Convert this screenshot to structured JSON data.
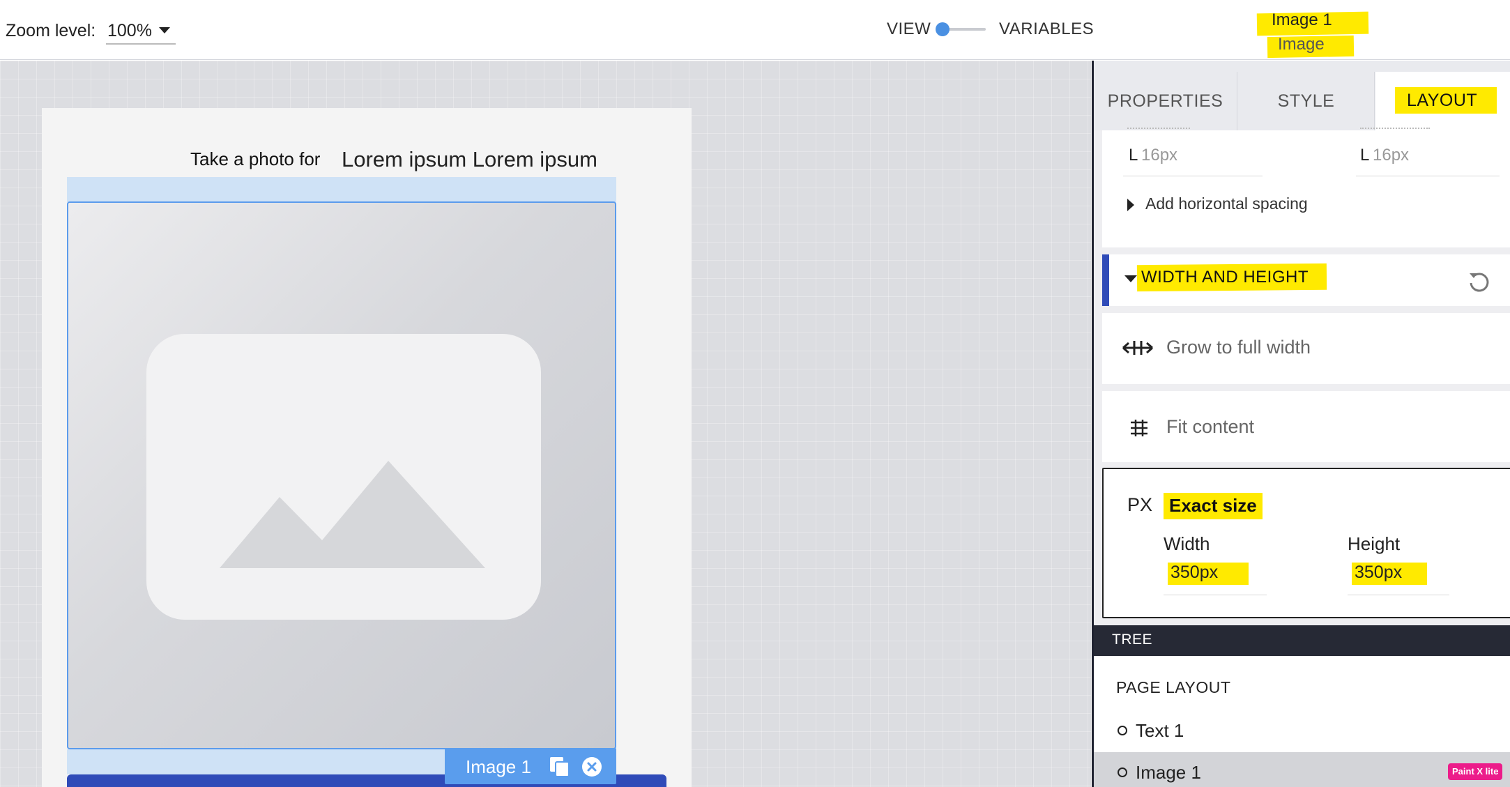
{
  "header": {
    "zoom_label": "Zoom level:",
    "zoom_value": "100%",
    "view_label": "VIEW",
    "variables_label": "VARIABLES",
    "selected_name": "Image 1",
    "selected_type": "Image"
  },
  "canvas": {
    "text_label": "Take a photo for",
    "text_value": "Lorem ipsum Lorem ipsum",
    "selection_label": "Image 1"
  },
  "panel": {
    "tabs": [
      {
        "label": "PROPERTIES",
        "active": false
      },
      {
        "label": "STYLE",
        "active": false
      },
      {
        "label": "LAYOUT",
        "active": true
      }
    ],
    "spacing": {
      "left_prefix": "L",
      "left_value": "16px",
      "right_prefix": "L",
      "right_value": "16px",
      "add_horizontal": "Add horizontal spacing"
    },
    "width_height": {
      "title": "WIDTH AND HEIGHT",
      "grow_full_width": "Grow to full width",
      "fit_content": "Fit content",
      "unit": "PX",
      "exact_size": "Exact size",
      "width_label": "Width",
      "width_value": "350px",
      "height_label": "Height",
      "height_value": "350px"
    },
    "tree": {
      "header": "TREE",
      "page_layout": "PAGE LAYOUT",
      "items": [
        "Text 1",
        "Image 1"
      ]
    },
    "watermark": "Paint X lite"
  }
}
